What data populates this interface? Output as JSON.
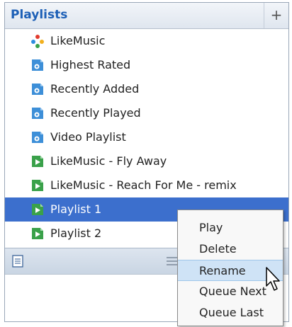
{
  "header": {
    "title": "Playlists",
    "add_label": "+"
  },
  "playlists": [
    {
      "label": "LikeMusic",
      "icon": "likemusic-logo-icon"
    },
    {
      "label": "Highest Rated",
      "icon": "smart-playlist-icon"
    },
    {
      "label": "Recently Added",
      "icon": "smart-playlist-icon"
    },
    {
      "label": "Recently Played",
      "icon": "smart-playlist-icon"
    },
    {
      "label": "Video Playlist",
      "icon": "smart-playlist-icon"
    },
    {
      "label": "LikeMusic - Fly Away",
      "icon": "playlist-icon"
    },
    {
      "label": "LikeMusic - Reach For Me - remix",
      "icon": "playlist-icon"
    },
    {
      "label": "Playlist 1",
      "icon": "playlist-icon",
      "selected": true
    },
    {
      "label": "Playlist 2",
      "icon": "playlist-icon"
    }
  ],
  "context_menu": {
    "items": [
      "Play",
      "Delete",
      "Rename",
      "Queue Next",
      "Queue Last"
    ],
    "highlighted": "Rename"
  },
  "colors": {
    "title": "#1c5fb6",
    "selection": "#3c6fcd",
    "smart_icon": "#3d8fd8",
    "playlist_icon": "#3aa14a",
    "menu_hover": "#cfe3f6"
  }
}
